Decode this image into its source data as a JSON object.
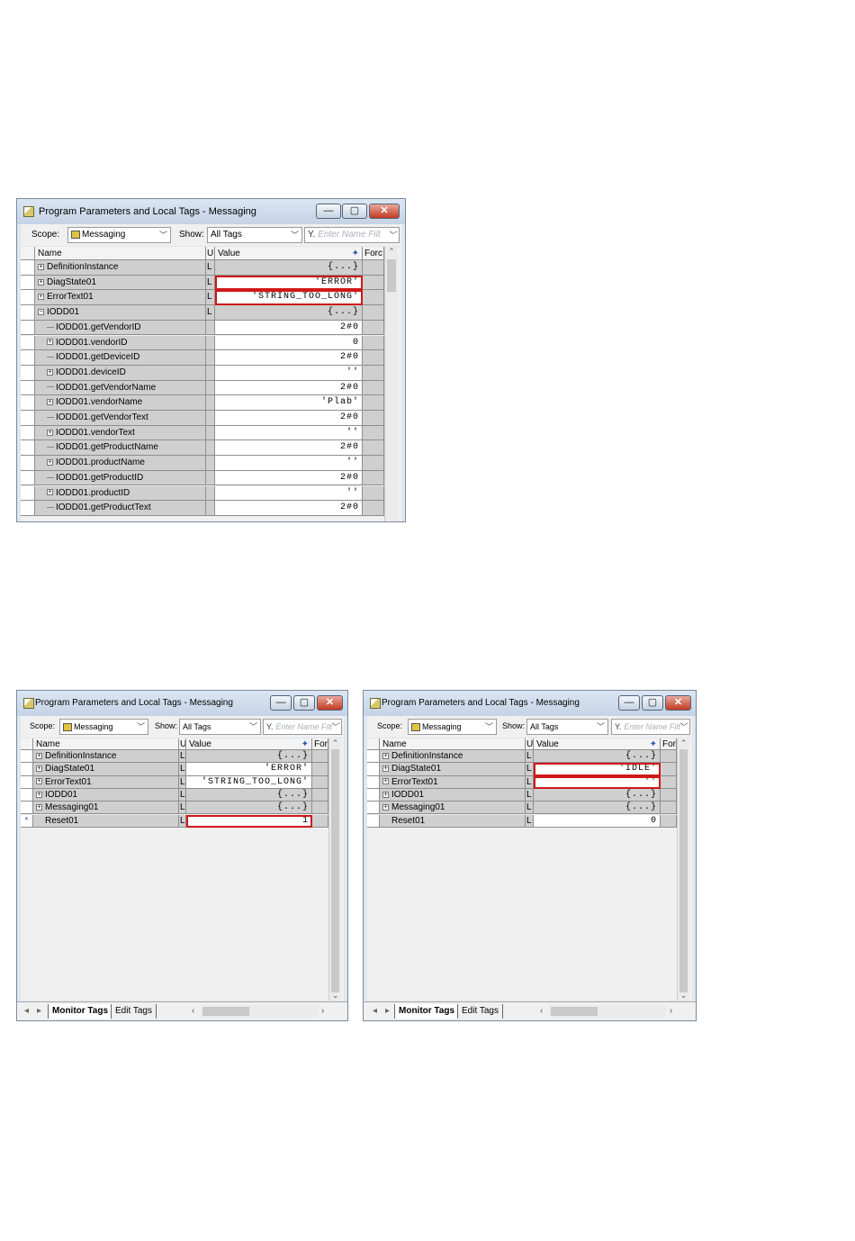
{
  "window": {
    "title": "Program Parameters and Local Tags - Messaging",
    "min_glyph": "—",
    "max_glyph": "▢",
    "close_glyph": "✕"
  },
  "toolbar": {
    "scope_label": "Scope:",
    "scope_value": "Messaging",
    "show_label": "Show:",
    "show_value": "All Tags",
    "filter_placeholder": "Enter Name Filt"
  },
  "columns": {
    "name": "Name",
    "u": "U",
    "value": "Value",
    "sort_glyph": "✦",
    "force": "Forc"
  },
  "top_rows": [
    {
      "name": "DefinitionInstance",
      "u": "L",
      "value": "{...}",
      "exp": "+",
      "indent": 0
    },
    {
      "name": "DiagState01",
      "u": "L",
      "value": "'ERROR'",
      "exp": "+",
      "indent": 0
    },
    {
      "name": "ErrorText01",
      "u": "L",
      "value": "'STRING_TOO_LONG'",
      "exp": "+",
      "indent": 0
    },
    {
      "name": "IODD01",
      "u": "L",
      "value": "{...}",
      "exp": "−",
      "indent": 0
    },
    {
      "name": "IODD01.getVendorID",
      "u": "",
      "value": "2#0",
      "exp": "",
      "indent": 1
    },
    {
      "name": "IODD01.vendorID",
      "u": "",
      "value": "0",
      "exp": "+",
      "indent": 1
    },
    {
      "name": "IODD01.getDeviceID",
      "u": "",
      "value": "2#0",
      "exp": "",
      "indent": 1
    },
    {
      "name": "IODD01.deviceID",
      "u": "",
      "value": "''",
      "exp": "+",
      "indent": 1
    },
    {
      "name": "IODD01.getVendorName",
      "u": "",
      "value": "2#0",
      "exp": "",
      "indent": 1
    },
    {
      "name": "IODD01.vendorName",
      "u": "",
      "value": "'Plab'",
      "exp": "+",
      "indent": 1
    },
    {
      "name": "IODD01.getVendorText",
      "u": "",
      "value": "2#0",
      "exp": "",
      "indent": 1
    },
    {
      "name": "IODD01.vendorText",
      "u": "",
      "value": "''",
      "exp": "+",
      "indent": 1
    },
    {
      "name": "IODD01.getProductName",
      "u": "",
      "value": "2#0",
      "exp": "",
      "indent": 1
    },
    {
      "name": "IODD01.productName",
      "u": "",
      "value": "''",
      "exp": "+",
      "indent": 1
    },
    {
      "name": "IODD01.getProductID",
      "u": "",
      "value": "2#0",
      "exp": "",
      "indent": 1
    },
    {
      "name": "IODD01.productID",
      "u": "",
      "value": "''",
      "exp": "+",
      "indent": 1
    },
    {
      "name": "IODD01.getProductText",
      "u": "",
      "value": "2#0",
      "exp": "",
      "indent": 1
    }
  ],
  "left_rows": [
    {
      "name": "DefinitionInstance",
      "u": "L",
      "value": "{...}",
      "exp": "+"
    },
    {
      "name": "DiagState01",
      "u": "L",
      "value": "'ERROR'",
      "exp": "+"
    },
    {
      "name": "ErrorText01",
      "u": "L",
      "value": "'STRING_TOO_LONG'",
      "exp": "+"
    },
    {
      "name": "IODD01",
      "u": "L",
      "value": "{...}",
      "exp": "+"
    },
    {
      "name": "Messaging01",
      "u": "L",
      "value": "{...}",
      "exp": "+"
    },
    {
      "name": "Reset01",
      "u": "L",
      "value": "1",
      "exp": "",
      "marker": "*"
    }
  ],
  "right_rows": [
    {
      "name": "DefinitionInstance",
      "u": "L",
      "value": "{...}",
      "exp": "+"
    },
    {
      "name": "DiagState01",
      "u": "L",
      "value": "'IDLE'",
      "exp": "+"
    },
    {
      "name": "ErrorText01",
      "u": "L",
      "value": "''",
      "exp": "+"
    },
    {
      "name": "IODD01",
      "u": "L",
      "value": "{...}",
      "exp": "+"
    },
    {
      "name": "Messaging01",
      "u": "L",
      "value": "{...}",
      "exp": "+"
    },
    {
      "name": "Reset01",
      "u": "L",
      "value": "0",
      "exp": ""
    }
  ],
  "tabs": {
    "monitor": "Monitor Tags",
    "edit": "Edit Tags"
  }
}
